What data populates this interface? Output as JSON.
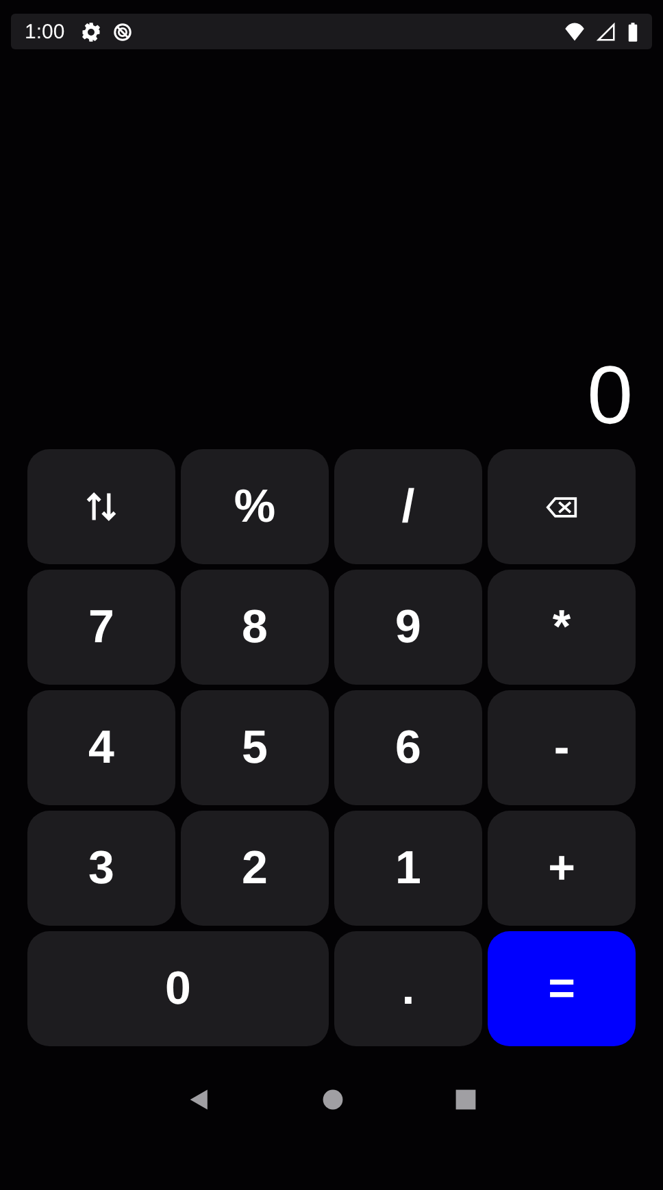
{
  "status_bar": {
    "time": "1:00"
  },
  "display": {
    "value": "0"
  },
  "keys": [
    {
      "kind": "swap",
      "wide": false
    },
    {
      "kind": "text",
      "label": "%",
      "wide": false
    },
    {
      "kind": "text",
      "label": "/",
      "wide": false
    },
    {
      "kind": "backspace",
      "wide": false
    },
    {
      "kind": "text",
      "label": "7",
      "wide": false
    },
    {
      "kind": "text",
      "label": "8",
      "wide": false
    },
    {
      "kind": "text",
      "label": "9",
      "wide": false
    },
    {
      "kind": "text",
      "label": "*",
      "wide": false
    },
    {
      "kind": "text",
      "label": "4",
      "wide": false
    },
    {
      "kind": "text",
      "label": "5",
      "wide": false
    },
    {
      "kind": "text",
      "label": "6",
      "wide": false
    },
    {
      "kind": "text",
      "label": "-",
      "wide": false
    },
    {
      "kind": "text",
      "label": "3",
      "wide": false
    },
    {
      "kind": "text",
      "label": "2",
      "wide": false
    },
    {
      "kind": "text",
      "label": "1",
      "wide": false
    },
    {
      "kind": "text",
      "label": "+",
      "wide": false
    },
    {
      "kind": "text",
      "label": "0",
      "wide": true
    },
    {
      "kind": "text",
      "label": ".",
      "wide": false
    },
    {
      "kind": "equals",
      "label": "=",
      "wide": false
    }
  ]
}
